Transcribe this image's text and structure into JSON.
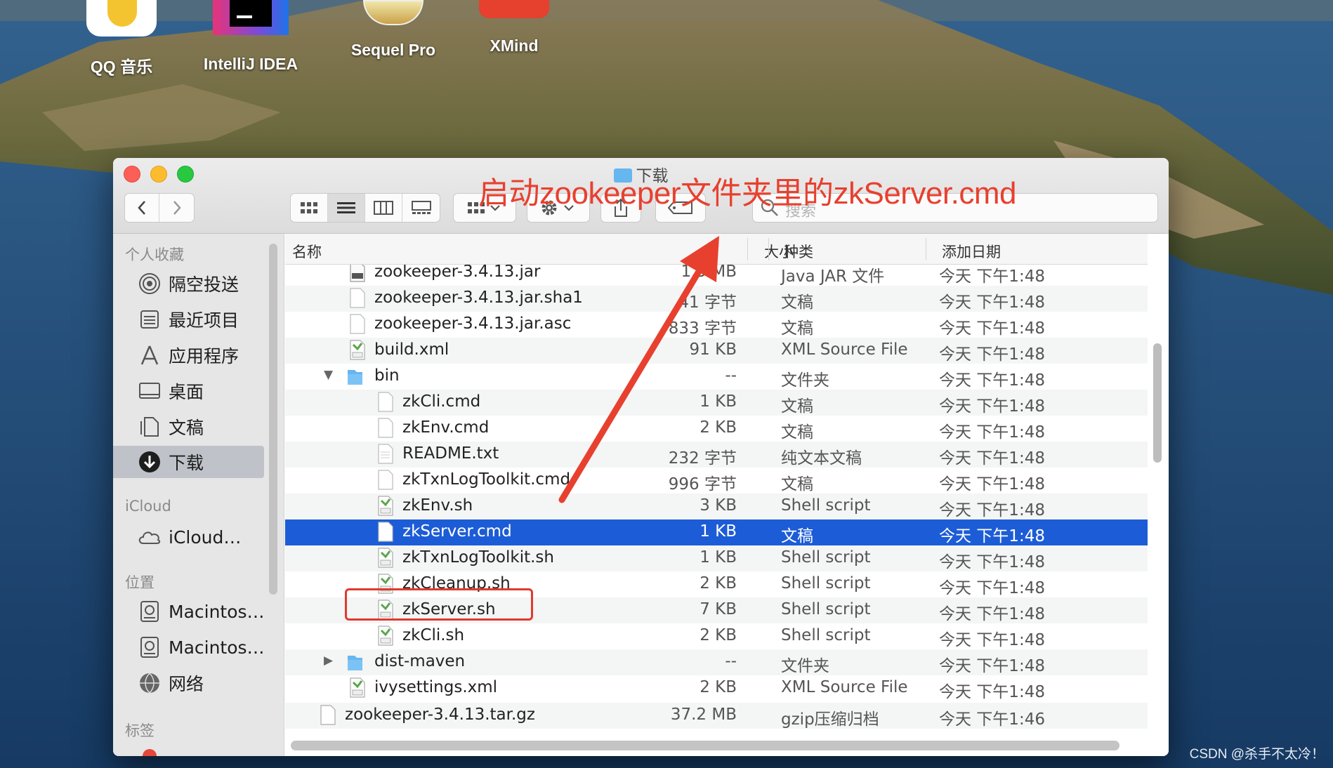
{
  "desktop": {
    "icons": [
      {
        "label": "QQ 音乐"
      },
      {
        "label": "IntelliJ IDEA"
      },
      {
        "label": "Sequel Pro"
      },
      {
        "label": "XMind"
      }
    ],
    "watermark": "CSDN @杀手不太冷！"
  },
  "window": {
    "title": "下载",
    "annotation": "启动zookeeper文件夹里的zkServer.cmd",
    "search_placeholder": "搜索"
  },
  "sidebar": {
    "sections": [
      {
        "title": "个人收藏",
        "items": [
          {
            "label": "隔空投送",
            "icon": "airdrop-icon"
          },
          {
            "label": "最近项目",
            "icon": "recents-icon"
          },
          {
            "label": "应用程序",
            "icon": "applications-icon"
          },
          {
            "label": "桌面",
            "icon": "desktop-icon"
          },
          {
            "label": "文稿",
            "icon": "documents-icon"
          },
          {
            "label": "下载",
            "icon": "downloads-icon",
            "selected": true
          }
        ]
      },
      {
        "title": "iCloud",
        "items": [
          {
            "label": "iCloud…",
            "icon": "cloud-icon"
          }
        ]
      },
      {
        "title": "位置",
        "items": [
          {
            "label": "Macintos…",
            "icon": "disk-icon"
          },
          {
            "label": "Macintos…",
            "icon": "disk-icon"
          },
          {
            "label": "网络",
            "icon": "network-icon"
          }
        ]
      },
      {
        "title": "标签",
        "items": []
      }
    ]
  },
  "list": {
    "columns": {
      "name": "名称",
      "size": "大小",
      "kind": "种类",
      "date": "添加日期"
    },
    "rows": [
      {
        "name": "zookeeper-3.4.13.jar",
        "size": "1.5 MB",
        "kind": "Java JAR 文件",
        "date": "今天 下午1:48",
        "icon": "jar-icon"
      },
      {
        "name": "zookeeper-3.4.13.jar.sha1",
        "size": "41 字节",
        "kind": "文稿",
        "date": "今天 下午1:48",
        "icon": "document-icon"
      },
      {
        "name": "zookeeper-3.4.13.jar.asc",
        "size": "833 字节",
        "kind": "文稿",
        "date": "今天 下午1:48",
        "icon": "document-icon"
      },
      {
        "name": "build.xml",
        "size": "91 KB",
        "kind": "XML Source File",
        "date": "今天 下午1:48",
        "icon": "xml-icon"
      },
      {
        "name": "bin",
        "size": "--",
        "kind": "文件夹",
        "date": "今天 下午1:48",
        "icon": "folder-icon",
        "expanded": true
      },
      {
        "name": "zkCli.cmd",
        "size": "1 KB",
        "kind": "文稿",
        "date": "今天 下午1:48",
        "icon": "document-icon"
      },
      {
        "name": "zkEnv.cmd",
        "size": "2 KB",
        "kind": "文稿",
        "date": "今天 下午1:48",
        "icon": "document-icon"
      },
      {
        "name": "README.txt",
        "size": "232 字节",
        "kind": "纯文本文稿",
        "date": "今天 下午1:48",
        "icon": "text-icon"
      },
      {
        "name": "zkTxnLogToolkit.cmd",
        "size": "996 字节",
        "kind": "文稿",
        "date": "今天 下午1:48",
        "icon": "document-icon"
      },
      {
        "name": "zkEnv.sh",
        "size": "3 KB",
        "kind": "Shell script",
        "date": "今天 下午1:48",
        "icon": "shell-script-icon"
      },
      {
        "name": "zkServer.cmd",
        "size": "1 KB",
        "kind": "文稿",
        "date": "今天 下午1:48",
        "icon": "document-icon",
        "selected": true
      },
      {
        "name": "zkTxnLogToolkit.sh",
        "size": "1 KB",
        "kind": "Shell script",
        "date": "今天 下午1:48",
        "icon": "shell-script-icon"
      },
      {
        "name": "zkCleanup.sh",
        "size": "2 KB",
        "kind": "Shell script",
        "date": "今天 下午1:48",
        "icon": "shell-script-icon"
      },
      {
        "name": "zkServer.sh",
        "size": "7 KB",
        "kind": "Shell script",
        "date": "今天 下午1:48",
        "icon": "shell-script-icon"
      },
      {
        "name": "zkCli.sh",
        "size": "2 KB",
        "kind": "Shell script",
        "date": "今天 下午1:48",
        "icon": "shell-script-icon"
      },
      {
        "name": "dist-maven",
        "size": "--",
        "kind": "文件夹",
        "date": "今天 下午1:48",
        "icon": "folder-icon",
        "expanded": false
      },
      {
        "name": "ivysettings.xml",
        "size": "2 KB",
        "kind": "XML Source File",
        "date": "今天 下午1:48",
        "icon": "xml-icon"
      },
      {
        "name": "zookeeper-3.4.13.tar.gz",
        "size": "37.2 MB",
        "kind": "gzip压缩归档",
        "date": "今天 下午1:46",
        "icon": "archive-icon"
      }
    ]
  },
  "colors": {
    "selection": "#1c5cd6",
    "annotation": "#e8402f",
    "folder": "#66b6f0"
  }
}
